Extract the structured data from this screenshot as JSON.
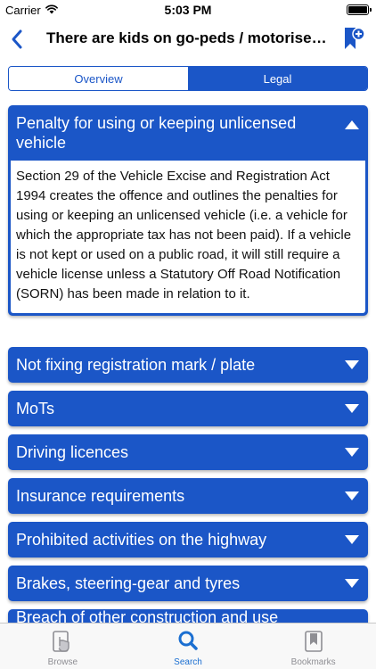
{
  "status_bar": {
    "carrier": "Carrier",
    "time": "5:03 PM"
  },
  "nav": {
    "title": "There are kids on go-peds / motorised scooters"
  },
  "segments": {
    "overview": "Overview",
    "legal": "Legal",
    "selected": "Legal"
  },
  "sections": [
    {
      "title": "Penalty for using or keeping unlicensed vehicle",
      "expanded": true,
      "body": "Section 29 of the Vehicle Excise and Registration Act 1994 creates the offence and outlines the penalties for using or keeping an unlicensed vehicle (i.e. a vehicle for which the appropriate tax has not been paid). If a vehicle is not kept or used on a public road, it will still require a vehicle license unless a Statutory Off Road Notification (SORN) has been made in relation to it."
    },
    {
      "title": "Not fixing registration mark / plate",
      "expanded": false
    },
    {
      "title": "MoTs",
      "expanded": false
    },
    {
      "title": "Driving licences",
      "expanded": false
    },
    {
      "title": "Insurance requirements",
      "expanded": false
    },
    {
      "title": "Prohibited activities on the highway",
      "expanded": false
    },
    {
      "title": "Brakes, steering-gear and tyres",
      "expanded": false
    },
    {
      "title": "Breach of other construction and use requirements",
      "expanded": false
    }
  ],
  "tabs": [
    {
      "label": "Browse",
      "icon": "browse-hand-icon",
      "active": false
    },
    {
      "label": "Search",
      "icon": "search-icon",
      "active": true
    },
    {
      "label": "Bookmarks",
      "icon": "bookmarks-icon",
      "active": false
    }
  ],
  "colors": {
    "accent": "#1b56c7",
    "tab_active": "#1b6fd1",
    "tab_inactive": "#8e8e93"
  }
}
